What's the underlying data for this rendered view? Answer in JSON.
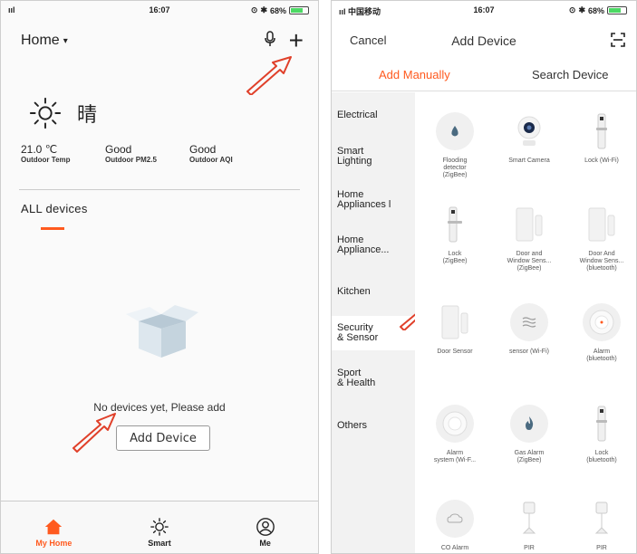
{
  "status_left": {
    "signal": "ııl",
    "time": "16:07",
    "battery": "68%"
  },
  "status_right": {
    "carrier": "ııl 中国移动",
    "time": "16:07",
    "battery": "68%"
  },
  "home": {
    "title": "Home",
    "weather_condition": "晴",
    "stats": [
      {
        "value": "21.0 ℃",
        "label": "Outdoor Temp"
      },
      {
        "value": "Good",
        "label": "Outdoor PM2.5"
      },
      {
        "value": "Good",
        "label": "Outdoor AQI"
      }
    ],
    "section_label": "ALL devices",
    "empty_message": "No devices yet, Please add",
    "add_button": "Add Device"
  },
  "tabbar": {
    "items": [
      {
        "label": "My Home",
        "icon": "house-icon",
        "active": true
      },
      {
        "label": "Smart",
        "icon": "sun-icon",
        "active": false
      },
      {
        "label": "Me",
        "icon": "user-icon",
        "active": false
      }
    ]
  },
  "add_device": {
    "cancel": "Cancel",
    "title": "Add Device",
    "tabs": {
      "manual": "Add Manually",
      "search": "Search Device"
    },
    "categories": [
      {
        "label": "Electrical"
      },
      {
        "label": "Smart\nLighting"
      },
      {
        "label": "Home\nAppliances l"
      },
      {
        "label": "Home\nAppliance..."
      },
      {
        "label": "Kitchen"
      },
      {
        "label": "Security\n& Sensor",
        "active": true
      },
      {
        "label": "Sport\n& Health"
      },
      {
        "label": "Others"
      }
    ],
    "devices": [
      {
        "name": "Flooding\ndetector\n(ZigBee)",
        "icon": "water-drop-icon"
      },
      {
        "name": "Smart Camera",
        "icon": "camera-icon"
      },
      {
        "name": "Lock (Wi-Fi)",
        "icon": "lock-icon"
      },
      {
        "name": "Lock\n(ZigBee)",
        "icon": "lock-icon"
      },
      {
        "name": "Door and\nWindow Sens...\n(ZigBee)",
        "icon": "door-sensor-icon"
      },
      {
        "name": "Door And\nWindow Sens...\n(bluetooth)",
        "icon": "door-sensor-icon"
      },
      {
        "name": "Door Sensor",
        "icon": "door-sensor-icon"
      },
      {
        "name": "sensor (Wi-Fi)",
        "icon": "wave-sensor-icon"
      },
      {
        "name": "Alarm\n(bluetooth)",
        "icon": "alarm-icon"
      },
      {
        "name": "Alarm\nsystem (Wi-F...",
        "icon": "alarm-icon"
      },
      {
        "name": "Gas Alarm\n(ZigBee)",
        "icon": "flame-icon"
      },
      {
        "name": "Lock\n(bluetooth)",
        "icon": "lock-icon"
      },
      {
        "name": "CO Alarm",
        "icon": "co-alarm-icon"
      },
      {
        "name": "PIR",
        "icon": "pir-icon"
      },
      {
        "name": "PIR",
        "icon": "pir-icon"
      }
    ]
  },
  "colors": {
    "accent": "#ff5a1f",
    "annotation_arrow": "#e0402a"
  }
}
